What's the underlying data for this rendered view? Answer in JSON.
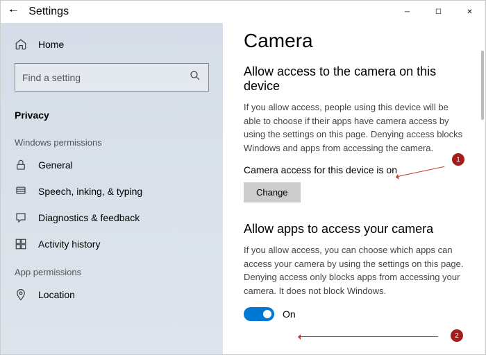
{
  "titlebar": {
    "title": "Settings"
  },
  "sidebar": {
    "home_label": "Home",
    "search_placeholder": "Find a setting",
    "selected": "Privacy",
    "section_windows": "Windows permissions",
    "items_windows": {
      "general": "General",
      "speech": "Speech, inking, & typing",
      "diagnostics": "Diagnostics & feedback",
      "activity": "Activity history"
    },
    "section_app": "App permissions",
    "items_app": {
      "location": "Location"
    }
  },
  "main": {
    "page_title": "Camera",
    "section1_title": "Allow access to the camera on this device",
    "section1_desc": "If you allow access, people using this device will be able to choose if their apps have camera access by using the settings on this page. Denying access blocks Windows and apps from accessing the camera.",
    "status_text": "Camera access for this device is on",
    "change_label": "Change",
    "section2_title": "Allow apps to access your camera",
    "section2_desc": "If you allow access, you can choose which apps can access your camera by using the settings on this page. Denying access only blocks apps from accessing your camera. It does not block Windows.",
    "toggle_label": "On"
  },
  "annotations": {
    "badge1": "1",
    "badge2": "2"
  }
}
